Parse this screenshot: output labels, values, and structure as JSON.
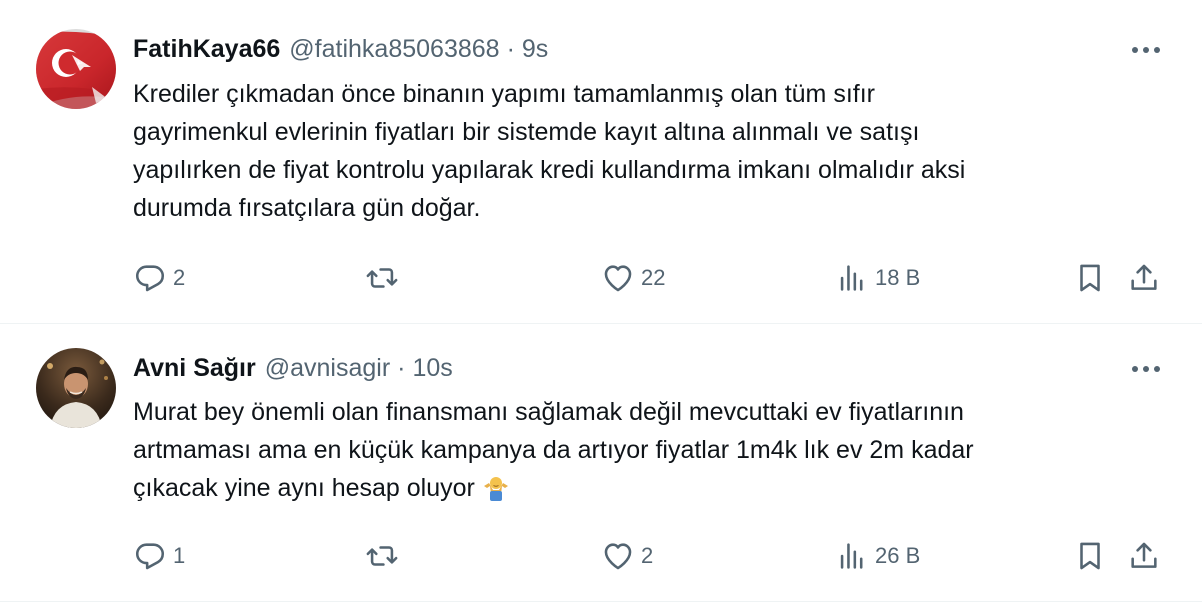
{
  "tweets": [
    {
      "author": {
        "display_name": "FatihKaya66",
        "handle": "@fatihka85063868",
        "avatar_icon": "turkish-flag-avatar"
      },
      "separator": "·",
      "time": "9s",
      "more_icon": "more-horizontal-icon",
      "text_lines": [
        "Krediler çıkmadan önce binanın yapımı tamamlanmış olan tüm sıfır",
        "gayrimenkul evlerinin fiyatları bir sistemde kayıt altına alınmalı ve satışı",
        "yapılırken de fiyat kontrolu yapılarak kredi kullandırma imkanı olmalıdır aksi",
        "durumda fırsatçılara gün doğar."
      ],
      "actions": {
        "replies": "2",
        "retweets": "",
        "likes": "22",
        "views": "18 B"
      }
    },
    {
      "author": {
        "display_name": "Avni Sağır",
        "handle": "@avnisagir",
        "avatar_icon": "person-photo-avatar"
      },
      "separator": "·",
      "time": "10s",
      "more_icon": "more-horizontal-icon",
      "text_lines": [
        "Murat bey önemli olan finansmanı sağlamak değil mevcuttaki ev fiyatlarının",
        "artmaması ama en küçük kampanya da artıyor fiyatlar 1m4k lık ev 2m kadar",
        "çıkacak yine aynı hesap oluyor"
      ],
      "trailing_emoji": "person-shrugging-emoji",
      "actions": {
        "replies": "1",
        "retweets": "",
        "likes": "2",
        "views": "26 B"
      }
    }
  ],
  "colors": {
    "text_primary": "#0f1419",
    "text_secondary": "#536471",
    "divider": "#eff3f4",
    "flag_red": "#e30a17"
  }
}
